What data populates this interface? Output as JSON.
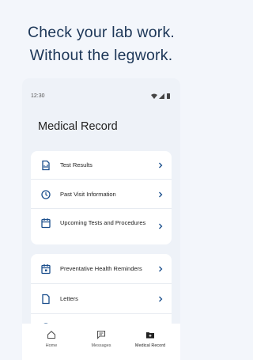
{
  "headline": {
    "line1": "Check your lab work.",
    "line2": "Without the legwork."
  },
  "status_bar": {
    "time": "12:30"
  },
  "page_title": "Medical Record",
  "sections": [
    {
      "items": [
        {
          "label": "Test Results",
          "icon": "test-results-icon"
        },
        {
          "label": "Past Visit Information",
          "icon": "past-visit-icon"
        },
        {
          "label": "Upcoming Tests and Procedures",
          "icon": "upcoming-tests-icon"
        }
      ]
    },
    {
      "items": [
        {
          "label": "Preventative Health Reminders",
          "icon": "calendar-icon"
        },
        {
          "label": "Letters",
          "icon": "letters-icon"
        },
        {
          "label": "",
          "icon": "allergies-icon"
        }
      ]
    }
  ],
  "tabbar": {
    "tabs": [
      {
        "label": "Home",
        "icon": "home-icon",
        "active": false
      },
      {
        "label": "Messages",
        "icon": "messages-icon",
        "active": false
      },
      {
        "label": "Medical Record",
        "icon": "medical-record-icon",
        "active": true
      }
    ]
  },
  "colors": {
    "headline": "#1c3657",
    "page_background": "#f3f6fb",
    "phone_background": "#eef2f8",
    "card": "#ffffff",
    "accent": "#1a4e8c"
  }
}
